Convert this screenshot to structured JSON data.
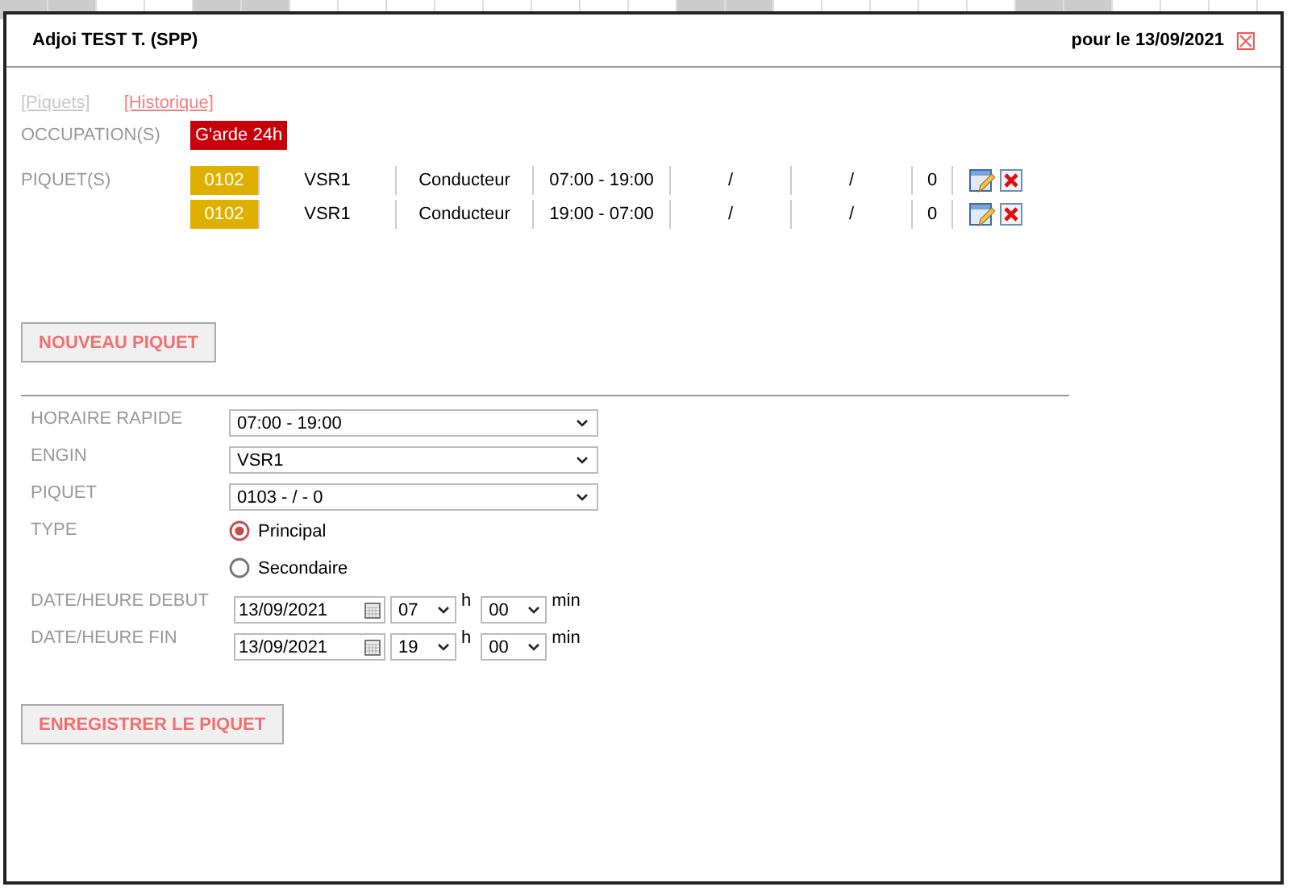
{
  "backdrop": {
    "cells": [
      {
        "shaded": true
      },
      {
        "shaded": true
      },
      {
        "shaded": false
      },
      {
        "shaded": false
      },
      {
        "shaded": true
      },
      {
        "shaded": true
      },
      {
        "shaded": false
      },
      {
        "shaded": false
      },
      {
        "shaded": false
      },
      {
        "shaded": false
      },
      {
        "shaded": false
      },
      {
        "shaded": false
      },
      {
        "shaded": false
      },
      {
        "shaded": false
      },
      {
        "shaded": true
      },
      {
        "shaded": true
      },
      {
        "shaded": false
      },
      {
        "shaded": false
      },
      {
        "shaded": false
      },
      {
        "shaded": false
      },
      {
        "shaded": false
      },
      {
        "shaded": true
      },
      {
        "shaded": true
      },
      {
        "shaded": false
      },
      {
        "shaded": false
      },
      {
        "shaded": false
      }
    ]
  },
  "window": {
    "title": "Adjoi TEST T. (SPP)",
    "date": "pour le 13/09/2021"
  },
  "links": [
    {
      "label": "[Piquets]",
      "selected": true
    },
    {
      "label": "[Historique]",
      "selected": false
    }
  ],
  "occupation": {
    "label": "OCCUPATION(S)",
    "badge": "G'arde 24h"
  },
  "piquets": {
    "label": "PIQUET(S)",
    "rows": [
      {
        "code": "0102",
        "engin": "VSR1",
        "role": "Conducteur",
        "hours": "07:00 - 19:00",
        "column_5": "/",
        "column_6": "/",
        "column_7": "0"
      },
      {
        "code": "0102",
        "engin": "VSR1",
        "role": "Conducteur",
        "hours": "19:00 - 07:00",
        "column_5": "/",
        "column_6": "/",
        "column_7": "0"
      }
    ]
  },
  "new_button": "NOUVEAU PIQUET",
  "form": {
    "selects": [
      {
        "label": "HORAIRE RAPIDE",
        "value": "07:00 - 19:00"
      },
      {
        "label": "ENGIN",
        "value": "VSR1"
      },
      {
        "label": "PIQUET",
        "value": "0103 - / - 0"
      }
    ],
    "type": {
      "label": "TYPE",
      "options": [
        {
          "label": "Principal",
          "selected": true
        },
        {
          "label": "Secondaire",
          "selected": false
        }
      ]
    },
    "dates": [
      {
        "label": "DATE/HEURE DEBUT",
        "date": "13/09/2021",
        "hour": "07",
        "h": "h",
        "minute": "00",
        "min": "min"
      },
      {
        "label": "DATE/HEURE FIN",
        "date": "13/09/2021",
        "hour": "19",
        "h": "h",
        "minute": "00",
        "min": "min"
      }
    ]
  },
  "save_button": "ENREGISTRER LE PIQUET"
}
